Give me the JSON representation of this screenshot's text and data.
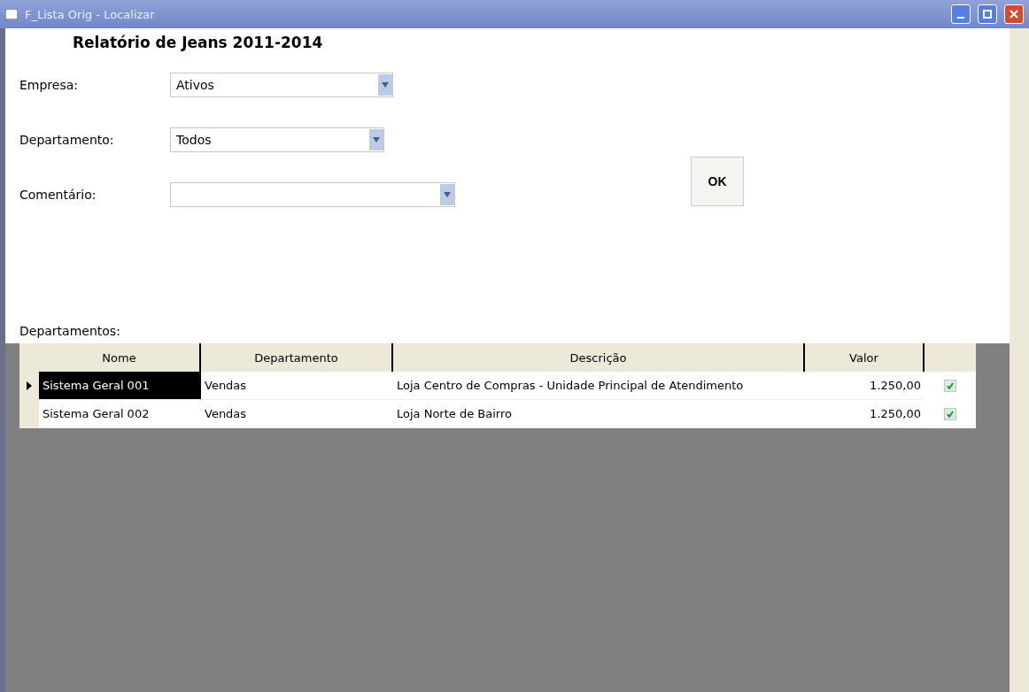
{
  "window": {
    "title": "F_Lista Orig - Localizar"
  },
  "heading": "Relatório de Jeans 2011-2014",
  "fields": [
    {
      "label": "Empresa:",
      "value": "Ativos"
    },
    {
      "label": "Departamento:",
      "value": "Todos"
    },
    {
      "label": "Comentário:"
    }
  ],
  "search_button": {
    "label": "OK"
  },
  "grid_label": "Departamentos:",
  "table": {
    "columns": [
      "Nome",
      "Departamento",
      "Descrição",
      "Valor"
    ],
    "rows": [
      {
        "selected": true,
        "cells": [
          "Sistema Geral 001",
          "Vendas",
          "Loja Centro de Compras - Unidade Principal de Atendimento",
          "1.250,00"
        ],
        "checked": true
      },
      {
        "selected": false,
        "cells": [
          "Sistema Geral 002",
          "Vendas",
          "Loja Norte de Bairro",
          "1.250,00"
        ],
        "checked": true
      }
    ]
  }
}
